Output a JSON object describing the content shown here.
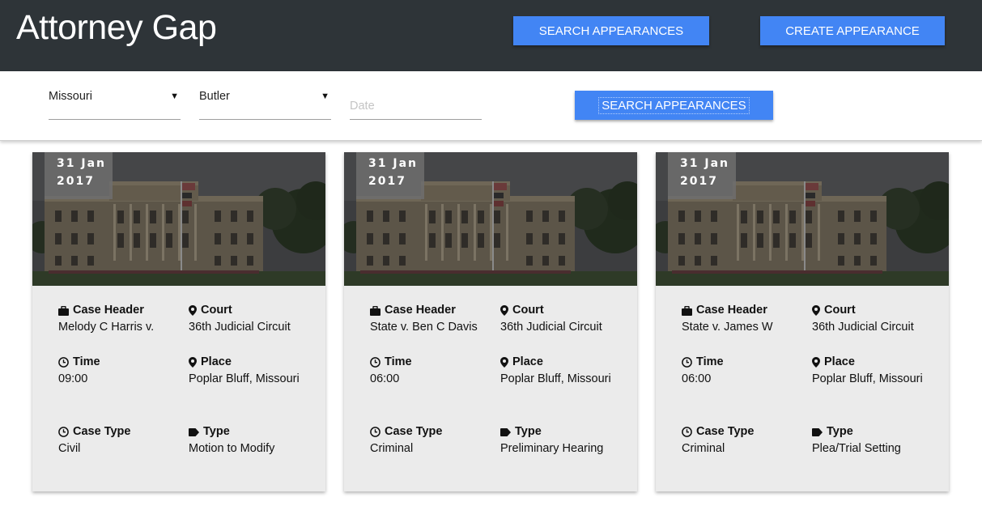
{
  "header": {
    "brand": "Attorney Gap",
    "search_button": "SEARCH APPEARANCES",
    "create_button": "CREATE APPEARANCE"
  },
  "filters": {
    "state": "Missouri",
    "county": "Butler",
    "date_placeholder": "Date",
    "search_button": "SEARCH APPEARANCES"
  },
  "labels": {
    "case_header": "Case Header",
    "court": "Court",
    "time": "Time",
    "place": "Place",
    "case_type": "Case Type",
    "type": "Type"
  },
  "cards": [
    {
      "day": "31 Jan",
      "year": "2017",
      "case_header": "Melody C Harris v.",
      "court": "36th Judicial Circuit",
      "time": "09:00",
      "place": "Poplar Bluff, Missouri",
      "case_type": "Civil",
      "type": "Motion to Modify"
    },
    {
      "day": "31 Jan",
      "year": "2017",
      "case_header": "State v. Ben C Davis",
      "court": "36th Judicial Circuit",
      "time": "06:00",
      "place": "Poplar Bluff, Missouri",
      "case_type": "Criminal",
      "type": "Preliminary Hearing"
    },
    {
      "day": "31 Jan",
      "year": "2017",
      "case_header": "State v. James W",
      "court": "36th Judicial Circuit",
      "time": "06:00",
      "place": "Poplar Bluff, Missouri",
      "case_type": "Criminal",
      "type": "Plea/Trial Setting"
    }
  ],
  "icons": {
    "case_header": "briefcase-icon",
    "court": "map-pin-icon",
    "time": "clock-icon",
    "place": "map-pin-icon",
    "case_type": "clock-icon",
    "type": "tag-icon"
  },
  "colors": {
    "header_bg": "#2e3438",
    "accent": "#4285f4",
    "card_bg": "#ebebeb"
  }
}
